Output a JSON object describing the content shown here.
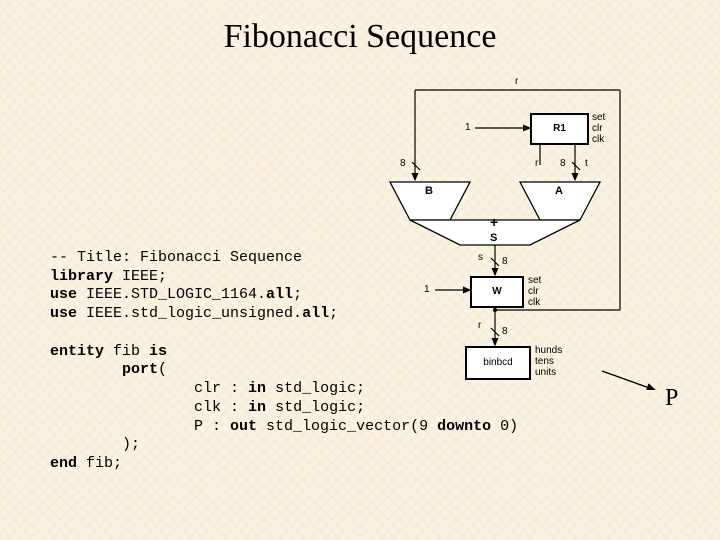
{
  "title": "Fibonacci Sequence",
  "code": {
    "c1": "-- Title: Fibonacci Sequence",
    "c2_a": "library",
    "c2_b": " IEEE;",
    "c3_a": "use",
    "c3_b": " IEEE.STD_LOGIC_1164.",
    "c3_c": "all",
    "c3_d": ";",
    "c4_a": "use",
    "c4_b": " IEEE.std_logic_unsigned.",
    "c4_c": "all",
    "c4_d": ";",
    "c5_a": "entity",
    "c5_b": " fib ",
    "c5_c": "is",
    "c6_a": "        port",
    "c6_b": "(",
    "c7_a": "                clr : ",
    "c7_b": "in",
    "c7_c": " std_logic;",
    "c8_a": "                clk : ",
    "c8_b": "in",
    "c8_c": " std_logic;",
    "c9_a": "                P : ",
    "c9_b": "out",
    "c9_c": " std_logic_vector(9 ",
    "c9_d": "downto",
    "c9_e": " 0)",
    "c10": "        );",
    "c11_a": "end",
    "c11_b": " fib;"
  },
  "diagram": {
    "r": "r",
    "one_top": "1",
    "R1": "R1",
    "set1": "set",
    "clr1": "clr",
    "clk1": "clk",
    "bus8a": "8",
    "bus8b": "8",
    "r2": "r",
    "t": "t",
    "B": "B",
    "A": "A",
    "plus": "+",
    "S": "S",
    "s_lbl": "s",
    "bus8c": "8",
    "one_bot": "1",
    "W": "W",
    "set2": "set",
    "clr2": "clr",
    "clk2": "clk",
    "r3": "r",
    "bus8d": "8",
    "binbcd": "binbcd",
    "hunds": "hunds",
    "tens": "tens",
    "units": "units"
  },
  "P_label": "P"
}
